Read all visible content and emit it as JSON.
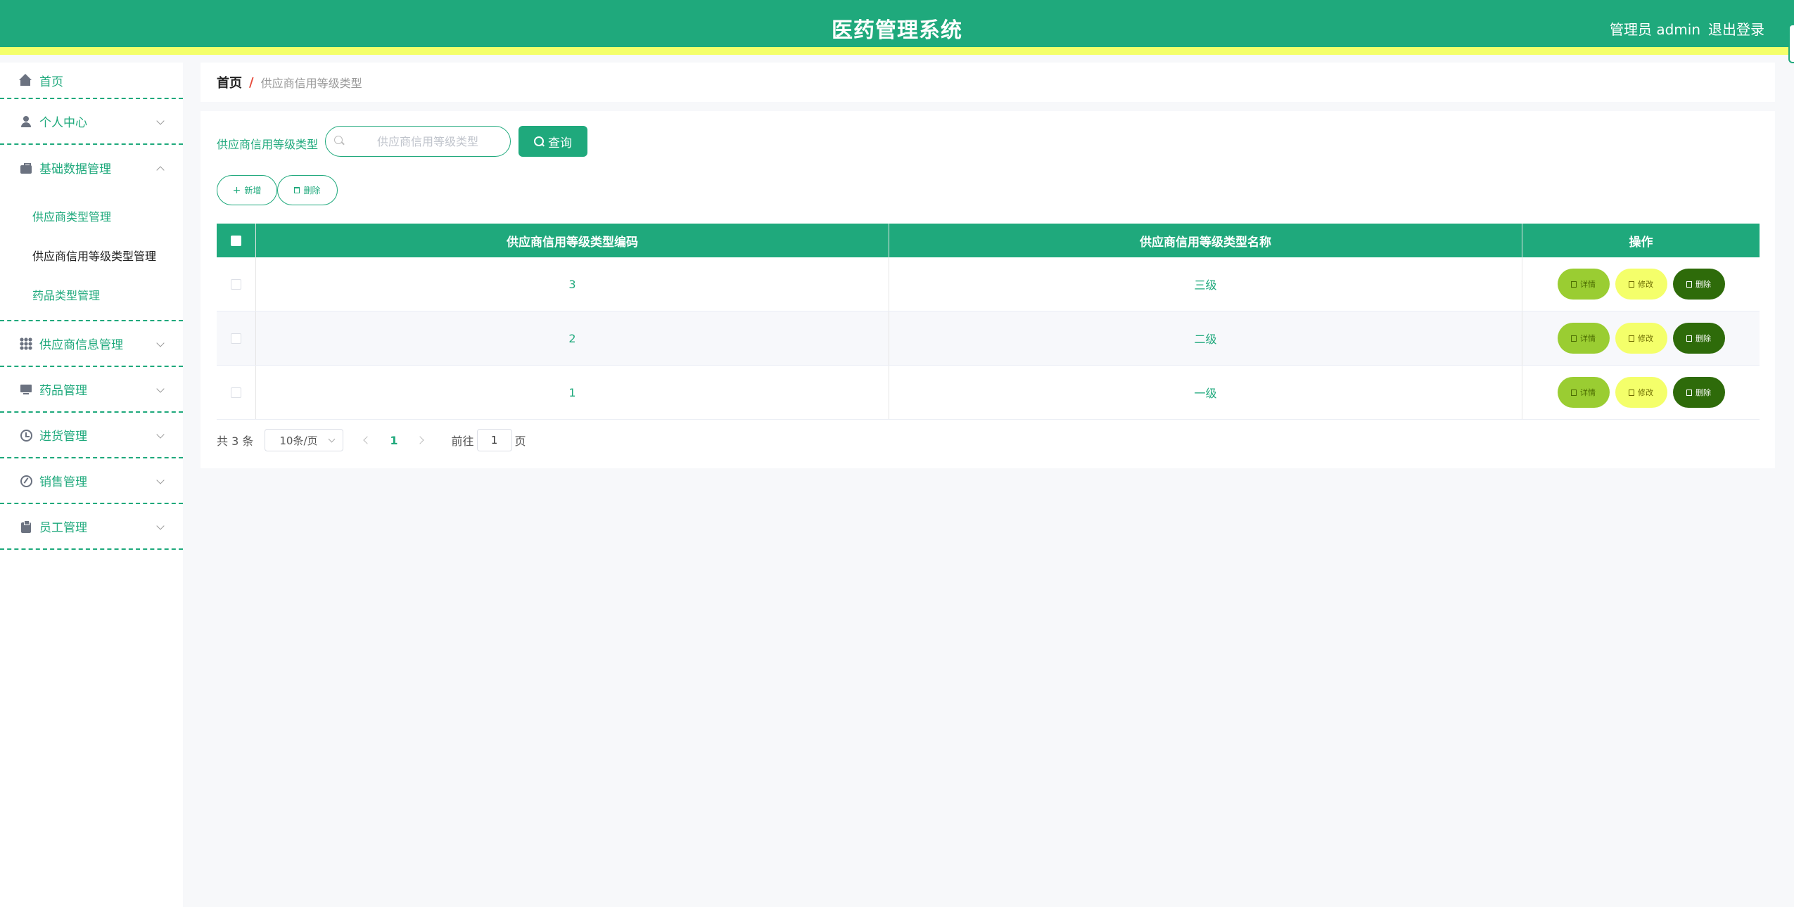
{
  "header": {
    "title": "医药管理系统",
    "user": "管理员 admin",
    "logout": "退出登录"
  },
  "sidebar": {
    "items": [
      {
        "label": "首页",
        "icon": "home-icon"
      },
      {
        "label": "个人中心",
        "icon": "user-icon"
      },
      {
        "label": "基础数据管理",
        "icon": "briefcase-icon",
        "expanded": true,
        "children": [
          "供应商类型管理",
          "供应商信用等级类型管理",
          "药品类型管理"
        ]
      },
      {
        "label": "供应商信息管理",
        "icon": "grid-icon"
      },
      {
        "label": "药品管理",
        "icon": "monitor-icon"
      },
      {
        "label": "进货管理",
        "icon": "clock-icon"
      },
      {
        "label": "销售管理",
        "icon": "compass-icon"
      },
      {
        "label": "员工管理",
        "icon": "clipboard-icon"
      }
    ],
    "active_child": "供应商信用等级类型管理"
  },
  "breadcrumb": {
    "home": "首页",
    "separator": "/",
    "current": "供应商信用等级类型"
  },
  "search": {
    "label": "供应商信用等级类型",
    "placeholder": "供应商信用等级类型",
    "value": "",
    "button": "查询"
  },
  "actions": {
    "add": "新增",
    "delete": "删除"
  },
  "table": {
    "columns": [
      "供应商信用等级类型编码",
      "供应商信用等级类型名称",
      "操作"
    ],
    "rows": [
      {
        "code": "3",
        "name": "三级"
      },
      {
        "code": "2",
        "name": "二级"
      },
      {
        "code": "1",
        "name": "一级"
      }
    ],
    "row_actions": {
      "detail": "详情",
      "edit": "修改",
      "delete": "删除"
    }
  },
  "pagination": {
    "total": "共 3 条",
    "page_size": "10条/页",
    "current_page": "1",
    "goto_label": "前往",
    "goto_value": "1",
    "page_suffix": "页"
  },
  "colors": {
    "primary": "#1fa97c",
    "header_stripe": "#f4ff6a",
    "detail_button": "#9acd32",
    "edit_button": "#f4ff6a",
    "delete_button": "#2e6b0a"
  }
}
